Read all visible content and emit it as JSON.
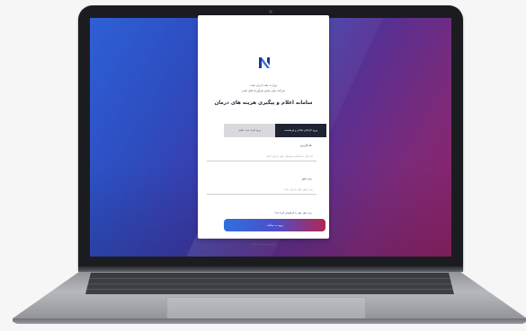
{
  "login": {
    "header_line1": "وزارت نفت ایران نفت",
    "header_line2": "شرکت ملی پخش فرآورده های نفتی",
    "title": "سامانه اعلام و پیگیری هزینه های درمان",
    "tabs": [
      {
        "label": "ورود کارکنان شاغل و بازنشسته",
        "active": true
      },
      {
        "label": "ورود افراد تحت تکفل",
        "active": false
      }
    ],
    "username_label": "نام کاربری",
    "username_placeholder": "کد ملی یا شماره پرسنلی خود را وارد کنید",
    "password_label": "رمز عبور",
    "password_placeholder": "رمز عبور خود را وارد کنید",
    "forgot_link": "رمز عبور خود را فراموش کرده اید؟",
    "submit_label": "ورود به سامانه",
    "footer_link": "راهنمای استفاده از سامانه"
  },
  "colors": {
    "accent_dark": "#1f2433",
    "gradient_start": "#2f6fe0",
    "gradient_end": "#b02752"
  },
  "icons": {
    "logo": "company-logo-icon",
    "webcam": "webcam-icon"
  }
}
